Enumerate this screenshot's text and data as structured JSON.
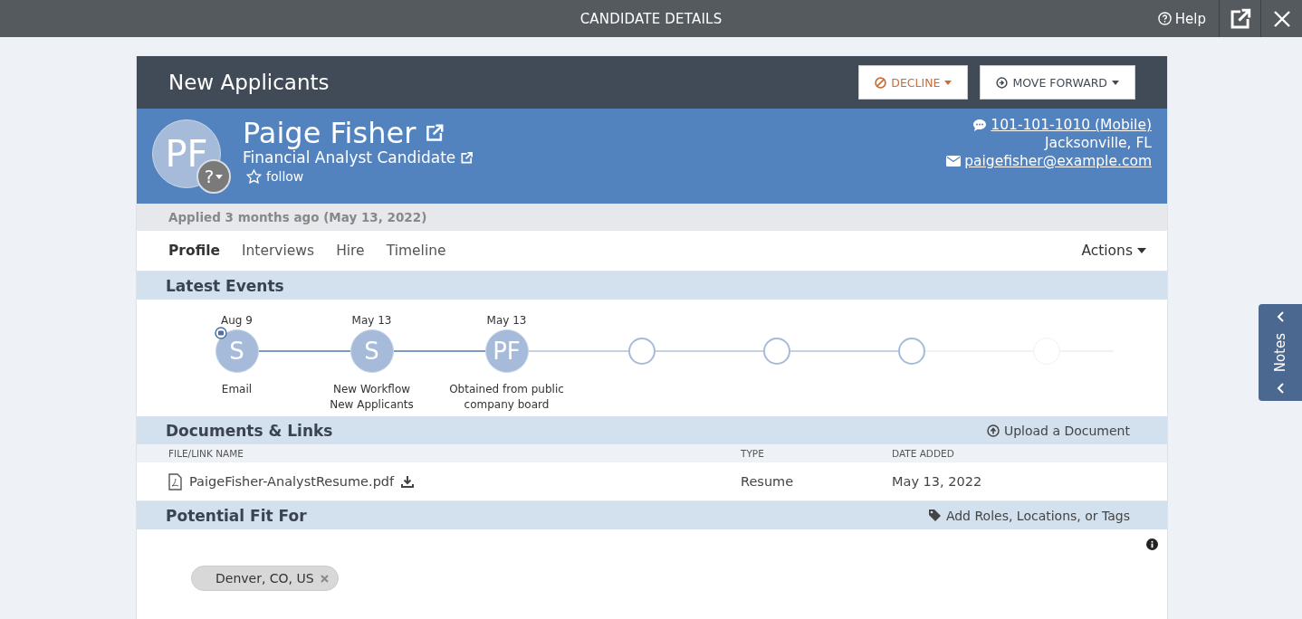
{
  "window": {
    "title": "CANDIDATE DETAILS",
    "help": "Help"
  },
  "stage": {
    "title": "New Applicants",
    "buttons": [
      {
        "label": "DECLINE",
        "kind": "decline"
      },
      {
        "label": "MOVE FORWARD",
        "kind": "forward"
      }
    ]
  },
  "candidate": {
    "initials": "PF",
    "badge": "?",
    "name": "Paige Fisher",
    "role": "Financial Analyst Candidate",
    "follow": "follow",
    "followed": false,
    "phone": "101-101-1010 (Mobile)",
    "location": "Jacksonville, FL",
    "email": "paigefisher@example.com"
  },
  "applied": "Applied 3 months ago (May 13, 2022)",
  "tabs": [
    {
      "label": "Profile",
      "selected": true
    },
    {
      "label": "Interviews",
      "selected": false
    },
    {
      "label": "Hire",
      "selected": false
    },
    {
      "label": "Timeline",
      "selected": false
    }
  ],
  "actions": "Actions",
  "latest_events": {
    "title": "Latest Events",
    "events": [
      {
        "kind": "event",
        "date": "Aug 9",
        "initials": "S",
        "label": "Email",
        "email_badge": true
      },
      {
        "kind": "event",
        "date": "May 13",
        "initials": "S",
        "label": "New Workflow\nNew Applicants",
        "email_badge": false
      },
      {
        "kind": "event",
        "date": "May 13",
        "initials": "PF",
        "label": "Obtained from public\ncompany board",
        "email_badge": false
      },
      {
        "kind": "empty"
      },
      {
        "kind": "empty"
      },
      {
        "kind": "empty"
      },
      {
        "kind": "faint"
      }
    ]
  },
  "documents": {
    "title": "Documents & Links",
    "upload": "Upload a Document",
    "columns": [
      "FILE/LINK NAME",
      "TYPE",
      "DATE ADDED"
    ],
    "rows": [
      {
        "name": "PaigeFisher-AnalystResume.pdf",
        "type": "Resume",
        "date": "May 13, 2022"
      }
    ]
  },
  "potential_fit": {
    "title": "Potential Fit For",
    "add": "Add Roles, Locations, or Tags",
    "tags": [
      "Denver, CO, US"
    ]
  },
  "notes": {
    "label": "Notes"
  }
}
